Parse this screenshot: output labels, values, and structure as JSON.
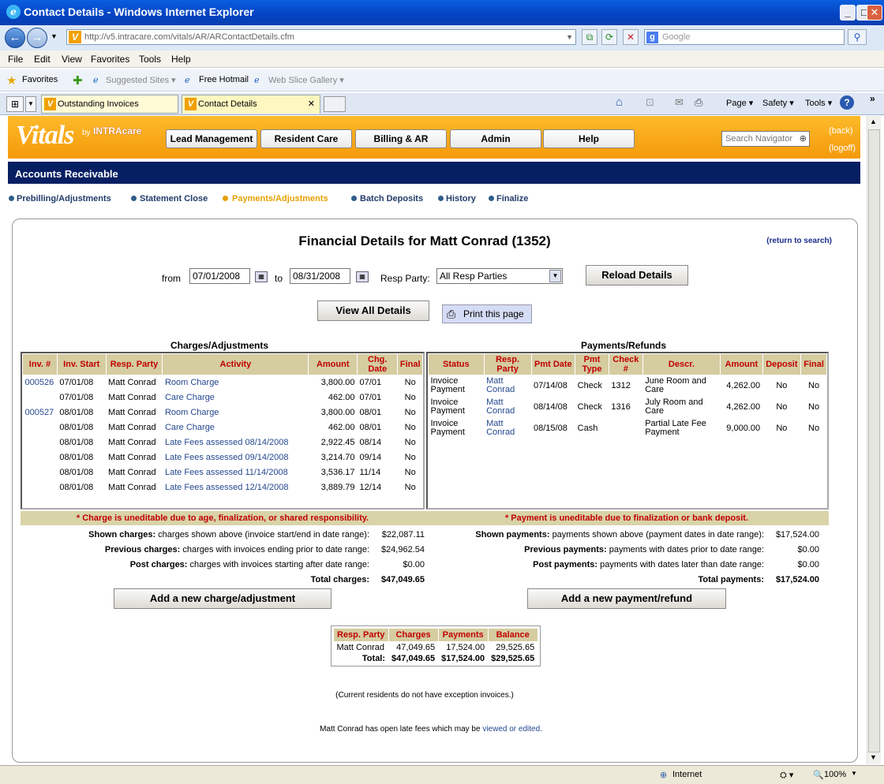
{
  "window": {
    "title": "Contact Details - Windows Internet Explorer"
  },
  "browser": {
    "url": "http://v5.intracare.com/vitals/AR/ARContactDetails.cfm",
    "search_placeholder": "Google",
    "menu": [
      "File",
      "Edit",
      "View",
      "Favorites",
      "Tools",
      "Help"
    ],
    "favorites_label": "Favorites",
    "favorites_links": [
      "Suggested Sites ▾",
      "Free Hotmail",
      "Web Slice Gallery ▾"
    ],
    "tabs": [
      {
        "label": "Outstanding Invoices"
      },
      {
        "label": "Contact Details"
      }
    ],
    "commands": [
      "Page ▾",
      "Safety ▾",
      "Tools ▾"
    ],
    "status": {
      "zone": "Internet",
      "zoom": "100%"
    }
  },
  "app": {
    "logo": "Vitals",
    "logo_by": "by",
    "logo_brand": "INTRAcare",
    "nav": [
      "Lead Management",
      "Resident Care",
      "Billing & AR",
      "Admin",
      "Help"
    ],
    "search_placeholder": "Search Navigator",
    "back": "(back)",
    "logoff": "(logoff)",
    "section": "Accounts Receivable",
    "subnav": [
      "Prebilling/Adjustments",
      "Statement Close",
      "Payments/Adjustments",
      "Batch Deposits",
      "History",
      "Finalize"
    ]
  },
  "page": {
    "title": "Financial Details for Matt Conrad (1352)",
    "return": "(return to search)",
    "from_label": "from",
    "from_date": "07/01/2008",
    "to_label": "to",
    "to_date": "08/31/2008",
    "resp_label": "Resp Party:",
    "resp_value": "All Resp Parties",
    "reload": "Reload Details",
    "view_all": "View All Details",
    "print": "Print this page"
  },
  "charges": {
    "title": "Charges/Adjustments",
    "headers": [
      "Inv. #",
      "Inv. Start",
      "Resp. Party",
      "Activity",
      "Amount",
      "Chg. Date",
      "Final"
    ],
    "rows": [
      [
        "000526",
        "07/01/08",
        "Matt Conrad",
        "Room Charge",
        "3,800.00",
        "07/01",
        "No"
      ],
      [
        "",
        "07/01/08",
        "Matt Conrad",
        "Care Charge",
        "462.00",
        "07/01",
        "No"
      ],
      [
        "000527",
        "08/01/08",
        "Matt Conrad",
        "Room Charge",
        "3,800.00",
        "08/01",
        "No"
      ],
      [
        "",
        "08/01/08",
        "Matt Conrad",
        "Care Charge",
        "462.00",
        "08/01",
        "No"
      ],
      [
        "",
        "08/01/08",
        "Matt Conrad",
        "Late Fees assessed 08/14/2008",
        "2,922.45",
        "08/14",
        "No"
      ],
      [
        "",
        "08/01/08",
        "Matt Conrad",
        "Late Fees assessed 09/14/2008",
        "3,214.70",
        "09/14",
        "No"
      ],
      [
        "",
        "08/01/08",
        "Matt Conrad",
        "Late Fees assessed 11/14/2008",
        "3,536.17",
        "11/14",
        "No"
      ],
      [
        "",
        "08/01/08",
        "Matt Conrad",
        "Late Fees assessed 12/14/2008",
        "3,889.79",
        "12/14",
        "No"
      ]
    ],
    "notice": "* Charge is uneditable due to age, finalization, or shared responsibility.",
    "summary": [
      {
        "bold": "Shown charges:",
        "text": "charges shown above (invoice start/end in date range):",
        "value": "$22,087.11"
      },
      {
        "bold": "Previous charges:",
        "text": "charges with invoices ending prior to date range:",
        "value": "$24,962.54"
      },
      {
        "bold": "Post charges:",
        "text": "charges with invoices starting after date range:",
        "value": "$0.00"
      }
    ],
    "total_label": "Total charges:",
    "total": "$47,049.65",
    "add": "Add a new charge/adjustment"
  },
  "payments": {
    "title": "Payments/Refunds",
    "headers": [
      "Status",
      "Resp. Party",
      "Pmt Date",
      "Pmt Type",
      "Check #",
      "Descr.",
      "Amount",
      "Deposit",
      "Final"
    ],
    "rows": [
      [
        "Invoice Payment",
        "Matt Conrad",
        "07/14/08",
        "Check",
        "1312",
        "June Room and Care",
        "4,262.00",
        "No",
        "No"
      ],
      [
        "Invoice Payment",
        "Matt Conrad",
        "08/14/08",
        "Check",
        "1316",
        "July Room and Care",
        "4,262.00",
        "No",
        "No"
      ],
      [
        "Invoice Payment",
        "Matt Conrad",
        "08/15/08",
        "Cash",
        "",
        "Partial Late Fee Payment",
        "9,000.00",
        "No",
        "No"
      ]
    ],
    "notice": "* Payment is uneditable due to finalization or bank deposit.",
    "summary": [
      {
        "bold": "Shown payments:",
        "text": "payments shown above (payment dates in date range):",
        "value": "$17,524.00"
      },
      {
        "bold": "Previous payments:",
        "text": "payments with dates prior to date range:",
        "value": "$0.00"
      },
      {
        "bold": "Post payments:",
        "text": "payments with dates later than date range:",
        "value": "$0.00"
      }
    ],
    "total_label": "Total payments:",
    "total": "$17,524.00",
    "add": "Add a new payment/refund"
  },
  "balance": {
    "headers": [
      "Resp. Party",
      "Charges",
      "Payments",
      "Balance"
    ],
    "row": [
      "Matt Conrad",
      "47,049.65",
      "17,524.00",
      "29,525.65"
    ],
    "total": [
      "Total:",
      "$47,049.65",
      "$17,524.00",
      "$29,525.65"
    ]
  },
  "notes": {
    "exception": "(Current residents do not have exception invoices.)",
    "latefees": "Matt Conrad has open late fees which may be",
    "latefees_link": "viewed or edited."
  }
}
